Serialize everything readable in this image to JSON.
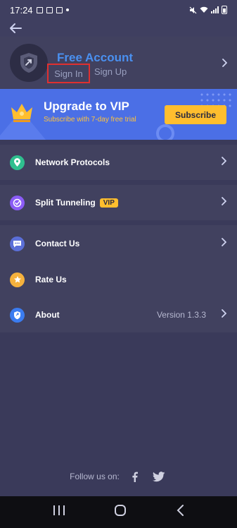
{
  "status_bar": {
    "time": "17:24"
  },
  "account": {
    "title": "Free Account",
    "sign_in": "Sign In",
    "sign_up": "Sign Up"
  },
  "vip": {
    "title": "Upgrade to VIP",
    "subtitle": "Subscribe with 7-day free trial",
    "subscribe": "Subscribe",
    "accent_color": "#ffbe2e",
    "banner_color": "#4b6fe6"
  },
  "menu": [
    {
      "label": "Network Protocols",
      "icon": "location-pin-icon",
      "icon_color": "#2fbf8f"
    },
    {
      "label": "Split Tunneling",
      "icon": "split-tunneling-icon",
      "icon_color": "#8b5cf6",
      "badge": "VIP"
    },
    {
      "label": "Contact Us",
      "icon": "chat-icon",
      "icon_color": "#5b6fd8"
    },
    {
      "label": "Rate Us",
      "icon": "star-icon",
      "icon_color": "#f5b13d"
    },
    {
      "label": "About",
      "icon": "shield-icon",
      "icon_color": "#3b7cf0",
      "value": "Version 1.3.3"
    }
  ],
  "footer": {
    "follow_text": "Follow us on:",
    "icons": [
      "facebook-icon",
      "twitter-icon"
    ]
  }
}
